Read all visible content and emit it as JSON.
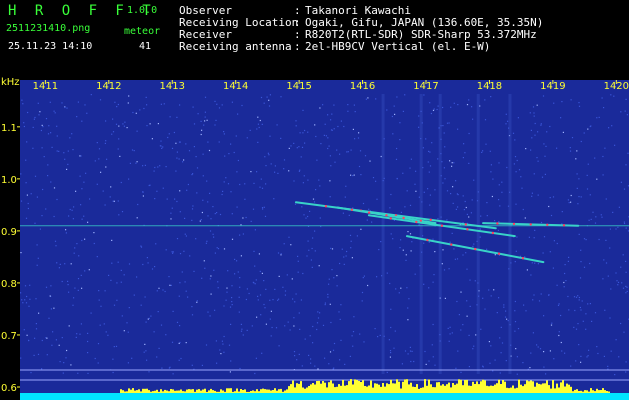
{
  "header": {
    "app_name": "H R O F F T",
    "version": "1.0.0",
    "file_name": "2511231410.png",
    "date_time": "25.11.23 14:10",
    "meteor_label": "meteor",
    "meteor_count": "41",
    "info": [
      {
        "key": "Observer",
        "sep": ":",
        "value": "Takanori Kawachi"
      },
      {
        "key": "Receiving Location",
        "sep": ":",
        "value": "Ogaki, Gifu, JAPAN (136.60E, 35.35N)"
      },
      {
        "key": "Receiver",
        "sep": ":",
        "value": "R820T2(RTL-SDR) SDR-Sharp 53.372MHz"
      },
      {
        "key": "Receiving antenna",
        "sep": ":",
        "value": "2el-HB9CV Vertical (el. E-W)"
      }
    ]
  },
  "chart_data": {
    "type": "heatmap",
    "xlabel": "",
    "ylabel": "kHz",
    "x_tick_labels": [
      "1411",
      "1412",
      "1413",
      "1414",
      "1415",
      "1416",
      "1417",
      "1418",
      "1419",
      "1420"
    ],
    "y_tick_labels": [
      "1.1",
      "1.0",
      "0.9",
      "0.8",
      "0.7",
      "0.6"
    ],
    "y_ticks": [
      1.1,
      1.0,
      0.9,
      0.8,
      0.7,
      0.6
    ],
    "x_range": [
      1410.6,
      1420.2
    ],
    "y_range": [
      0.575,
      1.19
    ],
    "carrier_khz": 0.91,
    "meteor_echoes": [
      {
        "x_start": 1414.95,
        "x_end": 1418.1,
        "y_start": 0.955,
        "y_end": 0.905
      },
      {
        "x_start": 1415.6,
        "x_end": 1417.15,
        "y_start": 0.945,
        "y_end": 0.915
      },
      {
        "x_start": 1416.7,
        "x_end": 1418.85,
        "y_start": 0.89,
        "y_end": 0.84
      },
      {
        "x_start": 1416.1,
        "x_end": 1418.4,
        "y_start": 0.93,
        "y_end": 0.89
      },
      {
        "x_start": 1417.9,
        "x_end": 1419.4,
        "y_start": 0.915,
        "y_end": 0.91
      }
    ],
    "colors": {
      "background": "#1a2a9a",
      "noise": "#3a55d8",
      "echo": "#39d3c8",
      "echo_hot": "#ff4060",
      "tick_labels": "#ffff33",
      "baseline_bar": "#00e5ff",
      "peaks": "#ffff33"
    }
  }
}
